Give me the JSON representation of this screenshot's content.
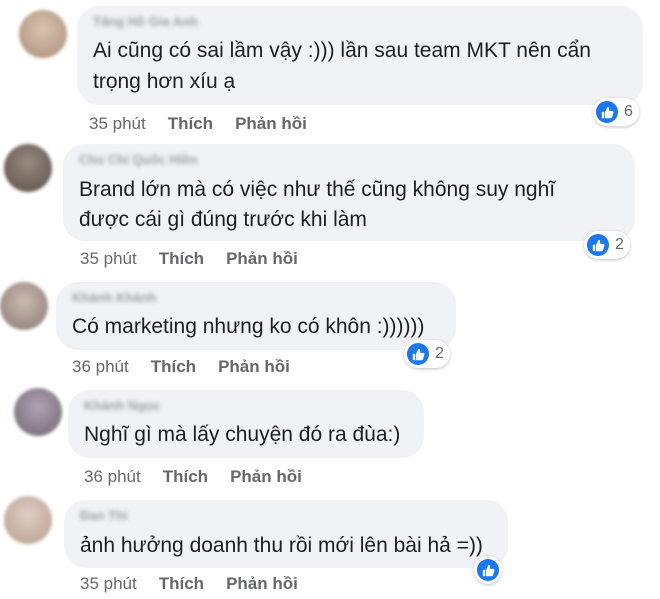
{
  "colors": {
    "like_blue": "#1877f2",
    "bubble": "#f0f2f5",
    "meta": "#65676b",
    "text": "#1c1e21"
  },
  "comments": [
    {
      "author": "Tăng Hồ Gia Anh",
      "lines": [
        "Ai cũng có sai lầm vậy :))) lần sau team MKT nên cẩn",
        "trọng hơn xíu ạ"
      ],
      "time": "35 phút",
      "like": "Thích",
      "reply": "Phản hồi",
      "reactions": "6",
      "reaction_icon": "like-icon"
    },
    {
      "author": "Chu Chí Quốc Hiền",
      "lines": [
        "Brand lớn mà có việc như thế cũng không suy nghĩ",
        "được cái gì đúng trước khi làm"
      ],
      "time": "35 phút",
      "like": "Thích",
      "reply": "Phản hồi",
      "reactions": "2",
      "reaction_icon": "like-icon"
    },
    {
      "author": "Khánh Khánh",
      "lines": [
        "Có marketing nhưng ko có khôn :))))))"
      ],
      "time": "36 phút",
      "like": "Thích",
      "reply": "Phản hồi",
      "reactions": "2",
      "reaction_icon": "like-icon"
    },
    {
      "author": "Khánh Ngọc",
      "lines": [
        "Nghĩ gì mà lấy chuyện đó ra đùa:)"
      ],
      "time": "36 phút",
      "like": "Thích",
      "reply": "Phản hồi",
      "reactions": "",
      "reaction_icon": ""
    },
    {
      "author": "Đan Thi",
      "lines": [
        "ảnh hưởng doanh thu rồi mới lên bài hả =))"
      ],
      "time": "35 phút",
      "like": "Thích",
      "reply": "Phản hồi",
      "reactions": "",
      "reaction_icon": "like-icon"
    }
  ]
}
